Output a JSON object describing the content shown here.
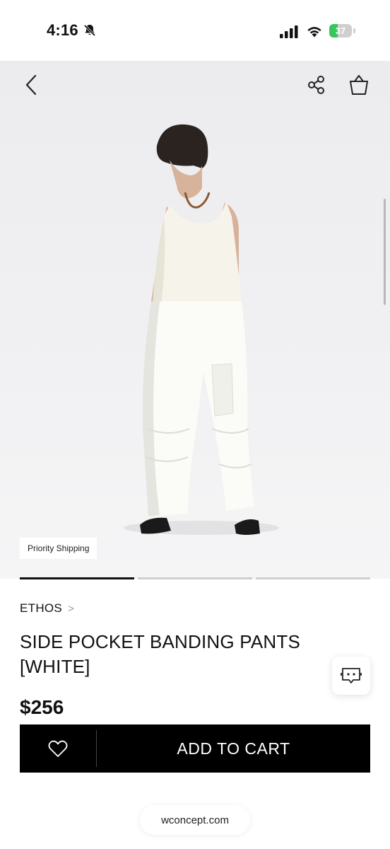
{
  "status_bar": {
    "time": "4:16",
    "battery_percent": "37",
    "battery_level": 0.37,
    "icons": [
      "bell-slash-icon",
      "signal-icon",
      "wifi-icon",
      "battery-charging-icon"
    ]
  },
  "header": {
    "icons": [
      "back-arrow-icon",
      "share-icon",
      "shopping-bag-icon"
    ]
  },
  "gallery": {
    "badge": "Priority Shipping",
    "current_page": 1,
    "total_pages": 3
  },
  "product": {
    "brand": "ETHOS",
    "brand_chevron": ">",
    "title": "SIDE POCKET BANDING PANTS [WHITE]",
    "price": "$256"
  },
  "actions": {
    "add_to_cart": "ADD TO CART",
    "wishlist_icon": "heart-icon",
    "chat_icon": "chat-bot-icon"
  },
  "browser": {
    "url": "wconcept.com"
  },
  "colors": {
    "accent": "#000000",
    "battery_fill": "#35c759",
    "background": "#ffffff"
  }
}
